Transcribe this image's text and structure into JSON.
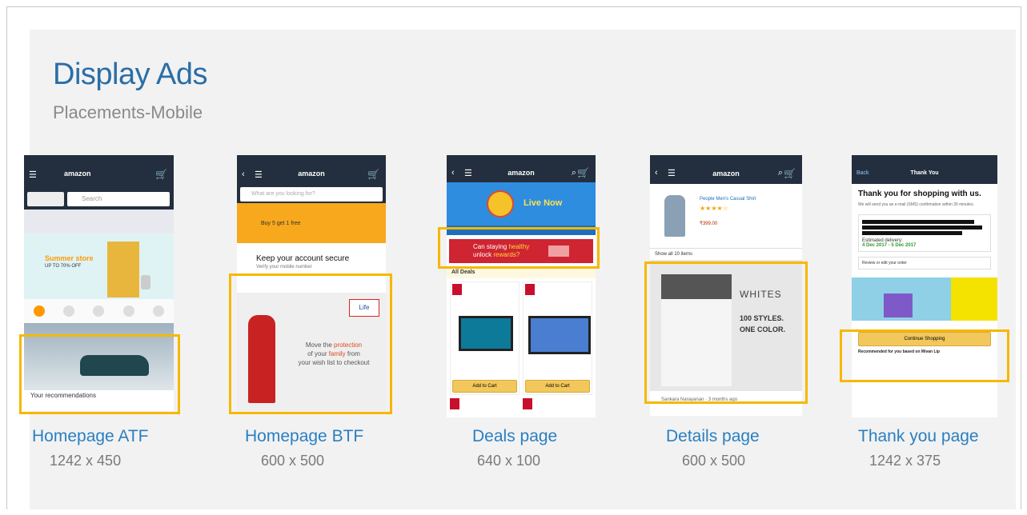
{
  "slide": {
    "title": "Display Ads",
    "subtitle": "Placements-Mobile"
  },
  "placements": [
    {
      "label": "Homepage ATF",
      "size": "1242 x 450"
    },
    {
      "label": "Homepage BTF",
      "size": "600 x 500"
    },
    {
      "label": "Deals page",
      "size": "640 x 100"
    },
    {
      "label": "Details page",
      "size": "600 x 500"
    },
    {
      "label": "Thank you page",
      "size": "1242 x 375"
    }
  ],
  "screens": {
    "homepage_atf": {
      "logo": "amazon",
      "search_placeholder": "Search",
      "banner_text": "Summer store",
      "banner_sub": "UP TO 70% OFF",
      "footer_text": "Your recommendations"
    },
    "homepage_btf": {
      "logo": "amazon",
      "search_placeholder": "What are you looking for?",
      "promo_text": "Buy 5 get 1 free",
      "secure_title": "Keep your account secure",
      "secure_sub": "Verify your mobile number",
      "ad_line1": "Move the",
      "ad_highlight1": "protection",
      "ad_line2": "of your",
      "ad_highlight2": "family",
      "ad_line3": "from",
      "ad_line4": "your wish list to checkout",
      "ad_brand": "Life"
    },
    "deals_page": {
      "logo": "amazon",
      "hero_text": "Live Now",
      "ad_line1": "Can staying",
      "ad_highlight1": "healthy",
      "ad_line2": "unlock",
      "ad_highlight2": "rewards?",
      "section": "All Deals",
      "add_to_cart": "Add to Cart"
    },
    "details_page": {
      "logo": "amazon",
      "product_title": "People Men's Casual Shirt",
      "price": "₹399.00",
      "link": "Show all 10 items",
      "ad_brand": "WHITES",
      "ad_line1": "100 STYLES.",
      "ad_line2": "ONE COLOR.",
      "reviewer": "Sankara Narayanan · 3 months ago"
    },
    "thank_you_page": {
      "back": "Back",
      "header": "Thank You",
      "heading": "Thank you for shopping with us.",
      "confirm_text": "We will send you an e-mail (SMS) confirmation within 30 minutes.",
      "delivery_label": "Estimated delivery:",
      "delivery_value": "4 Dec 2017 - 5 Dec 2017",
      "review_link": "Review or edit your order",
      "continue_button": "Continue Shopping",
      "recommend_text": "Recommended for you based on Mivan Lip"
    }
  }
}
